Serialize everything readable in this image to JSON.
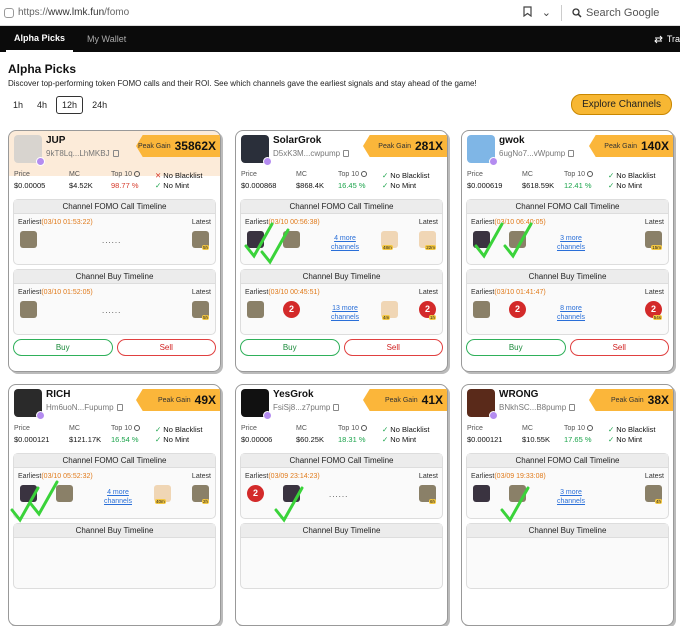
{
  "browser": {
    "url_prefix": "https://",
    "url_host": "www.lmk.fun",
    "url_path": "/fomo",
    "search_placeholder": "Search Google"
  },
  "nav": {
    "tabs": [
      {
        "label": "Alpha Picks",
        "active": true
      },
      {
        "label": "My Wallet",
        "active": false
      }
    ],
    "right_label": "Tra"
  },
  "page": {
    "title": "Alpha Picks",
    "subtitle": "Discover top-performing token FOMO calls and their ROI. See which channels gave the earliest signals and stay ahead of the game!"
  },
  "timeframes": [
    {
      "label": "1h",
      "active": false
    },
    {
      "label": "4h",
      "active": false
    },
    {
      "label": "12h",
      "active": true
    },
    {
      "label": "24h",
      "active": false
    }
  ],
  "explore_label": "Explore Channels",
  "labels": {
    "peak_gain": "Peak Gain",
    "price": "Price",
    "mc": "MC",
    "top10": "Top 10",
    "call_timeline": "Channel FOMO Call Timeline",
    "buy_timeline": "Channel Buy Timeline",
    "earliest": "Earliest",
    "latest": "Latest",
    "buy": "Buy",
    "sell": "Sell"
  },
  "colors": {
    "accent": "#fbb63a",
    "green": "#1aa34a",
    "red": "#d63a2a",
    "link": "#2a6fd8"
  },
  "tokens": [
    {
      "name": "JUP",
      "address": "9kT8Lq...LhMKBJ",
      "peak": "35862X",
      "price": "$0.00005",
      "mc": "$4.52K",
      "top10": "98.77 %",
      "top10_color": "red",
      "blacklist": "No Blacklist",
      "blacklist_ok": false,
      "mint": "No Mint",
      "call_earliest": "(03/10 01:53:22)",
      "call_middle": "......",
      "call_latest_tag": "5h",
      "buy_earliest": "(03/10 01:52:05)",
      "buy_middle": "......",
      "buy_latest_tag": "5h"
    },
    {
      "name": "SolarGrok",
      "address": "D5xK3M...cwpump",
      "peak": "281X",
      "price": "$0.000868",
      "mc": "$868.4K",
      "top10": "16.45 %",
      "top10_color": "green",
      "blacklist": "No Blacklist",
      "blacklist_ok": true,
      "mint": "No Mint",
      "call_earliest": "(03/10 00:56:38)",
      "call_middle": "4 more channels",
      "call_latest_tag": "22m",
      "call_prev_tag": "48m",
      "buy_earliest": "(03/10 00:45:51)",
      "buy_middle": "13 more channels",
      "buy_latest_tag": "1h",
      "buy_prev_tag": "4m"
    },
    {
      "name": "gwok",
      "address": "6ugNo7...vWpump",
      "peak": "140X",
      "price": "$0.000619",
      "mc": "$618.59K",
      "top10": "12.41 %",
      "top10_color": "green",
      "blacklist": "No Blacklist",
      "blacklist_ok": true,
      "mint": "No Mint",
      "call_earliest": "(03/10 06:40:05)",
      "call_middle": "3 more channels",
      "call_latest_tag": "15m",
      "buy_earliest": "(03/10 01:41:47)",
      "buy_middle": "8 more channels",
      "buy_latest_tag": "54s"
    },
    {
      "name": "RICH",
      "address": "Hm6uoN...Fupump",
      "peak": "49X",
      "price": "$0.000121",
      "mc": "$121.17K",
      "top10": "16.54 %",
      "top10_color": "green",
      "blacklist": "No Blacklist",
      "blacklist_ok": true,
      "mint": "No Mint",
      "call_earliest": "(03/10 05:52:32)",
      "call_middle": "4 more channels",
      "call_latest_tag": "2h",
      "call_prev_tag": "40m",
      "buy_title": "Channel Buy Timeline"
    },
    {
      "name": "YesGrok",
      "address": "FsiSj8...z7pump",
      "peak": "41X",
      "price": "$0.00006",
      "mc": "$60.25K",
      "top10": "18.31 %",
      "top10_color": "green",
      "blacklist": "No Blacklist",
      "blacklist_ok": true,
      "mint": "No Mint",
      "call_earliest": "(03/09 23:14:23)",
      "call_middle": "......",
      "call_latest_tag": "6h"
    },
    {
      "name": "WRONG",
      "address": "BNkhSC...B8pump",
      "peak": "38X",
      "price": "$0.000121",
      "mc": "$10.55K",
      "top10": "17.65 %",
      "top10_color": "green",
      "blacklist": "No Blacklist",
      "blacklist_ok": true,
      "mint": "No Mint",
      "call_earliest": "(03/09 19:33:08)",
      "call_middle": "3 more channels",
      "call_latest_tag": "4h"
    }
  ]
}
